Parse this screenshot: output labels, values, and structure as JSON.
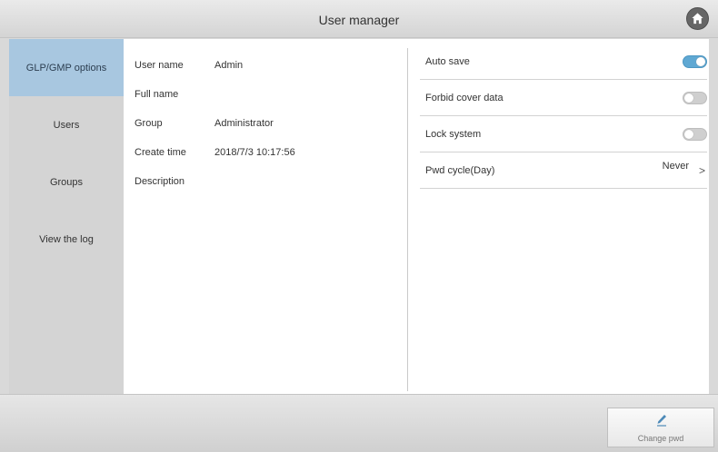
{
  "header": {
    "title": "User manager",
    "home_icon": "home-icon"
  },
  "sidebar": {
    "items": [
      {
        "label": "GLP/GMP options",
        "active": true
      },
      {
        "label": "Users",
        "active": false
      },
      {
        "label": "Groups",
        "active": false
      },
      {
        "label": "View the log",
        "active": false
      }
    ]
  },
  "user_info": {
    "user_name_label": "User name",
    "user_name_value": "Admin",
    "full_name_label": "Full name",
    "full_name_value": "",
    "group_label": "Group",
    "group_value": "Administrator",
    "create_time_label": "Create time",
    "create_time_value": "2018/7/3 10:17:56",
    "description_label": "Description",
    "description_value": ""
  },
  "settings": {
    "auto_save_label": "Auto save",
    "auto_save_on": true,
    "forbid_cover_label": "Forbid cover data",
    "forbid_cover_on": false,
    "lock_system_label": "Lock system",
    "lock_system_on": false,
    "pwd_cycle_label": "Pwd cycle(Day)",
    "pwd_cycle_value": "Never",
    "chevron": ">"
  },
  "footer": {
    "change_pwd_label": "Change pwd",
    "pen_icon": "pen-icon"
  },
  "colors": {
    "active_tab": "#a8c7e0",
    "toggle_on": "#5fa8d3",
    "toggle_off": "#cfcfcf"
  }
}
